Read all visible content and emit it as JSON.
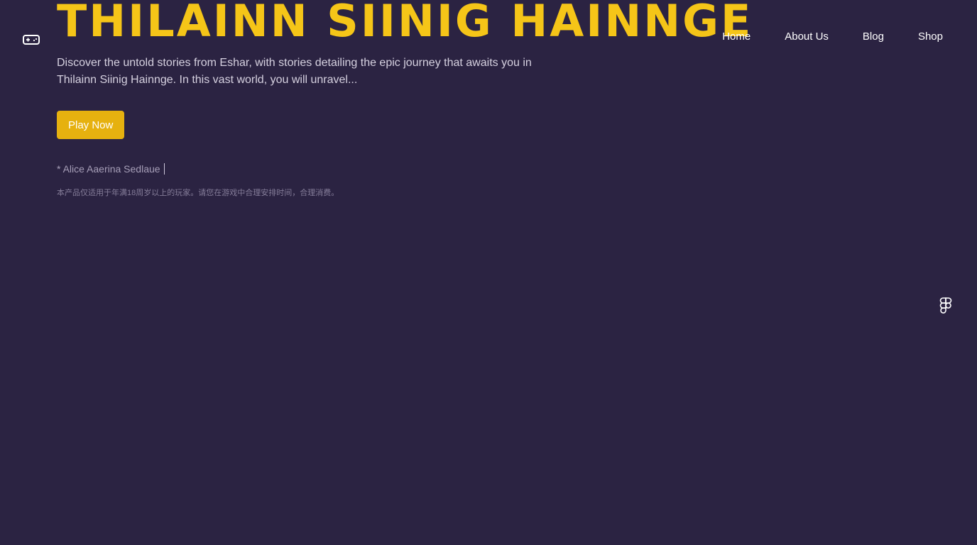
{
  "header": {
    "logo_icon": "gamepad-icon",
    "title": "THILAINN SIINIG HAINNGE",
    "nav": [
      {
        "label": "Home"
      },
      {
        "label": "About Us"
      },
      {
        "label": "Blog"
      },
      {
        "label": "Shop"
      }
    ]
  },
  "hero": {
    "description": "Discover the untold stories from Eshar, with stories detailing the epic journey that awaits you in Thilainn Siinig Hainnge. In this vast world, you will unravel...",
    "cta_label": "Play Now",
    "author_line": "* Alice Aaerina Sedlaue",
    "age_notice": "本产品仅适用于年满18周岁以上的玩家。请您在游戏中合理安排时间，合理消费。"
  },
  "floating": {
    "icon": "figma-icon"
  },
  "colors": {
    "background": "#2b2342",
    "accent": "#f5c518",
    "button": "#e6b10f",
    "text": "#ffffff"
  }
}
